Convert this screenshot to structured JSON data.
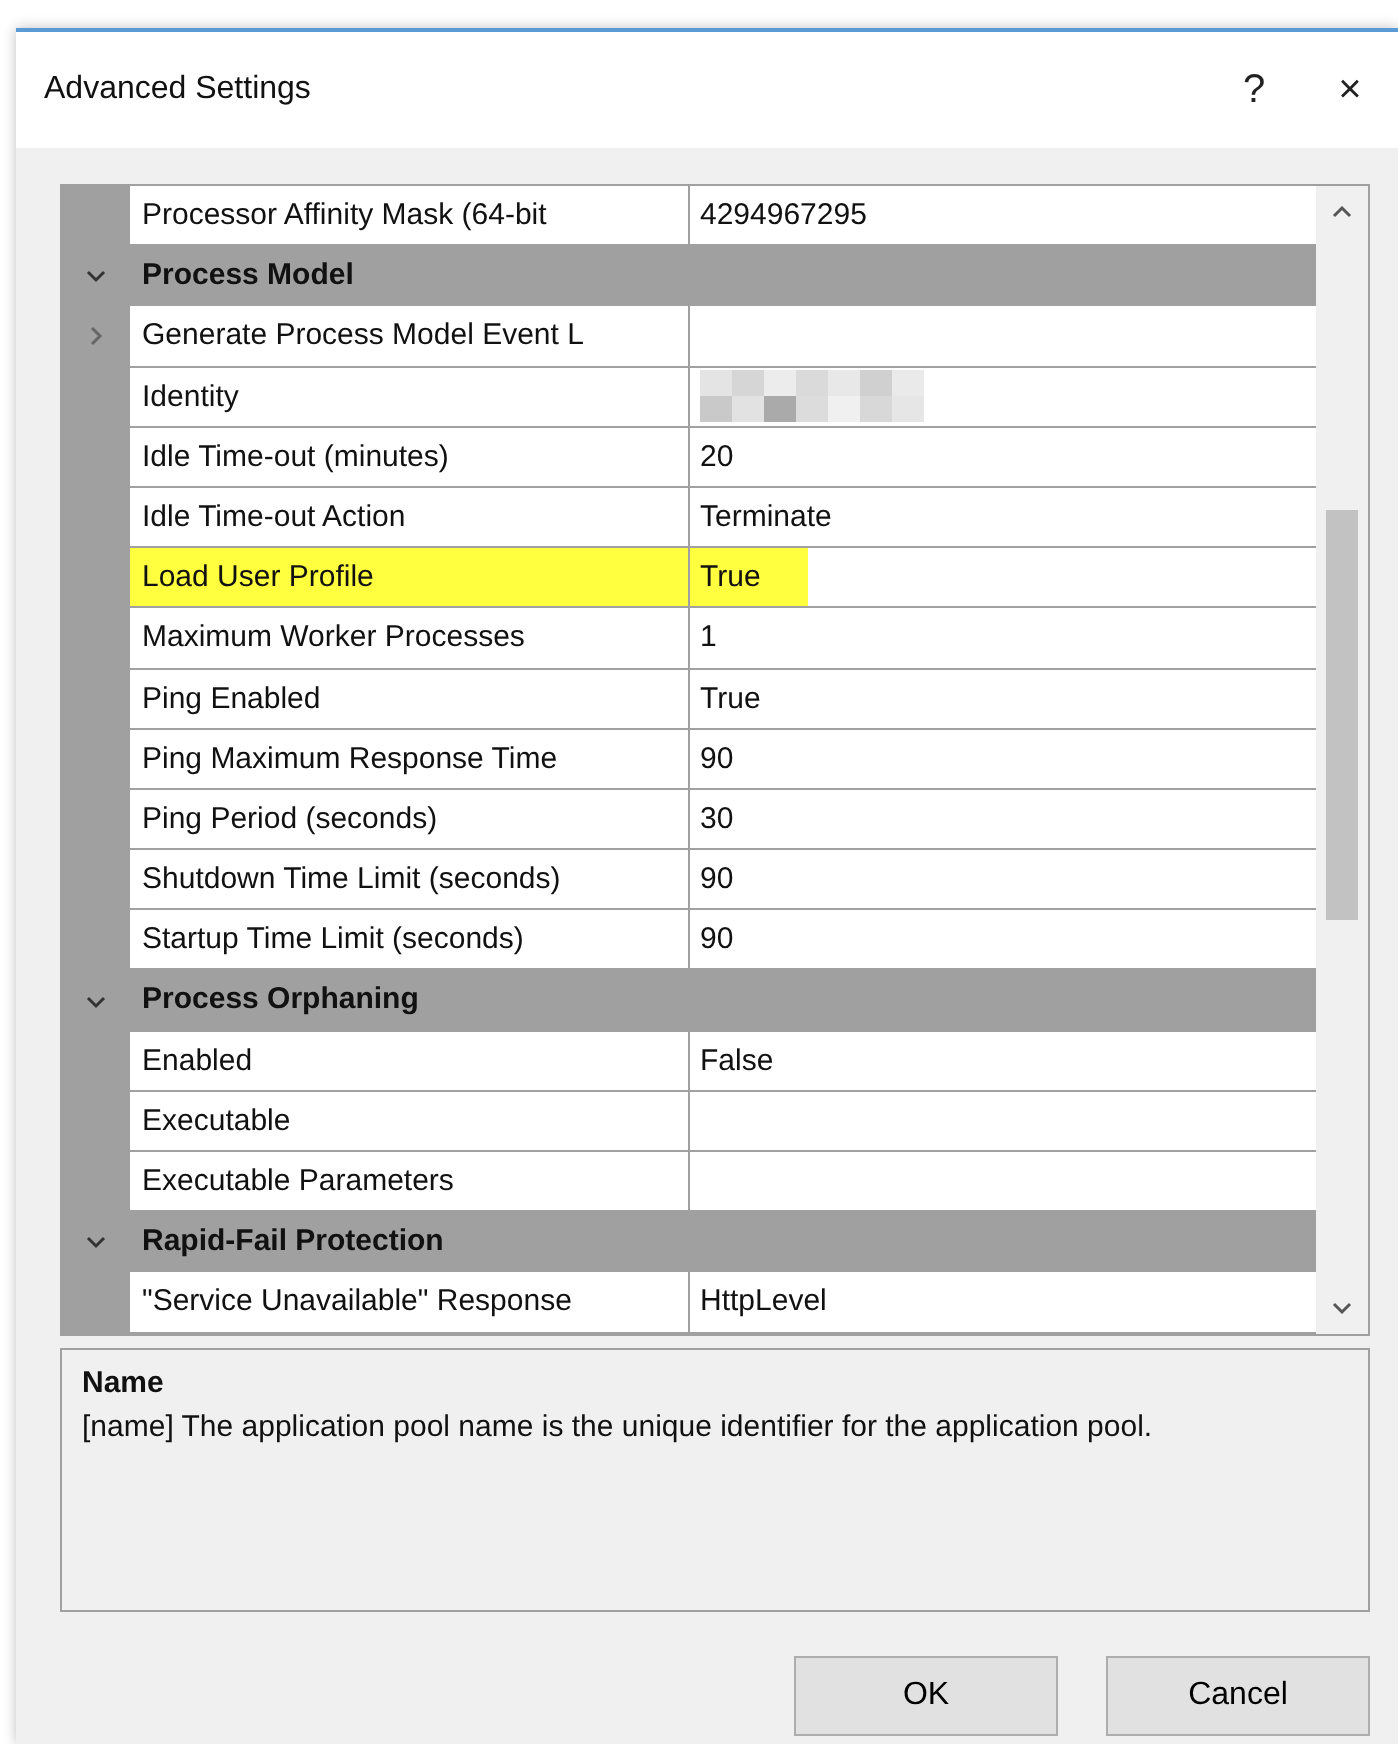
{
  "window": {
    "title": "Advanced Settings",
    "help_button": "?",
    "close_button": "×"
  },
  "grid": {
    "rows": [
      {
        "kind": "property",
        "name": "Processor Affinity Mask (64-bit",
        "value": "4294967295"
      },
      {
        "kind": "category",
        "name": "Process Model",
        "expanded": true
      },
      {
        "kind": "property",
        "name": "Generate Process Model Event L",
        "expandable": true,
        "expanded": false
      },
      {
        "kind": "property",
        "name": "Identity",
        "redacted": true
      },
      {
        "kind": "property",
        "name": "Idle Time-out (minutes)",
        "value": "20"
      },
      {
        "kind": "property",
        "name": "Idle Time-out Action",
        "value": "Terminate"
      },
      {
        "kind": "property",
        "name": "Load User Profile",
        "value": "True",
        "highlighted": true
      },
      {
        "kind": "property",
        "name": "Maximum Worker Processes",
        "value": "1"
      },
      {
        "kind": "property",
        "name": "Ping Enabled",
        "value": "True"
      },
      {
        "kind": "property",
        "name": "Ping Maximum Response Time",
        "value": "90"
      },
      {
        "kind": "property",
        "name": "Ping Period (seconds)",
        "value": "30"
      },
      {
        "kind": "property",
        "name": "Shutdown Time Limit (seconds)",
        "value": "90"
      },
      {
        "kind": "property",
        "name": "Startup Time Limit (seconds)",
        "value": "90"
      },
      {
        "kind": "category",
        "name": "Process Orphaning",
        "expanded": true
      },
      {
        "kind": "property",
        "name": "Enabled",
        "value": "False"
      },
      {
        "kind": "property",
        "name": "Executable"
      },
      {
        "kind": "property",
        "name": "Executable Parameters"
      },
      {
        "kind": "category",
        "name": "Rapid-Fail Protection",
        "expanded": true
      },
      {
        "kind": "property",
        "name": "\"Service Unavailable\" Response",
        "value": "HttpLevel"
      }
    ]
  },
  "description": {
    "title": "Name",
    "text": "[name] The application pool name is the unique identifier for the application pool."
  },
  "buttons": [
    "OK",
    "Cancel"
  ]
}
